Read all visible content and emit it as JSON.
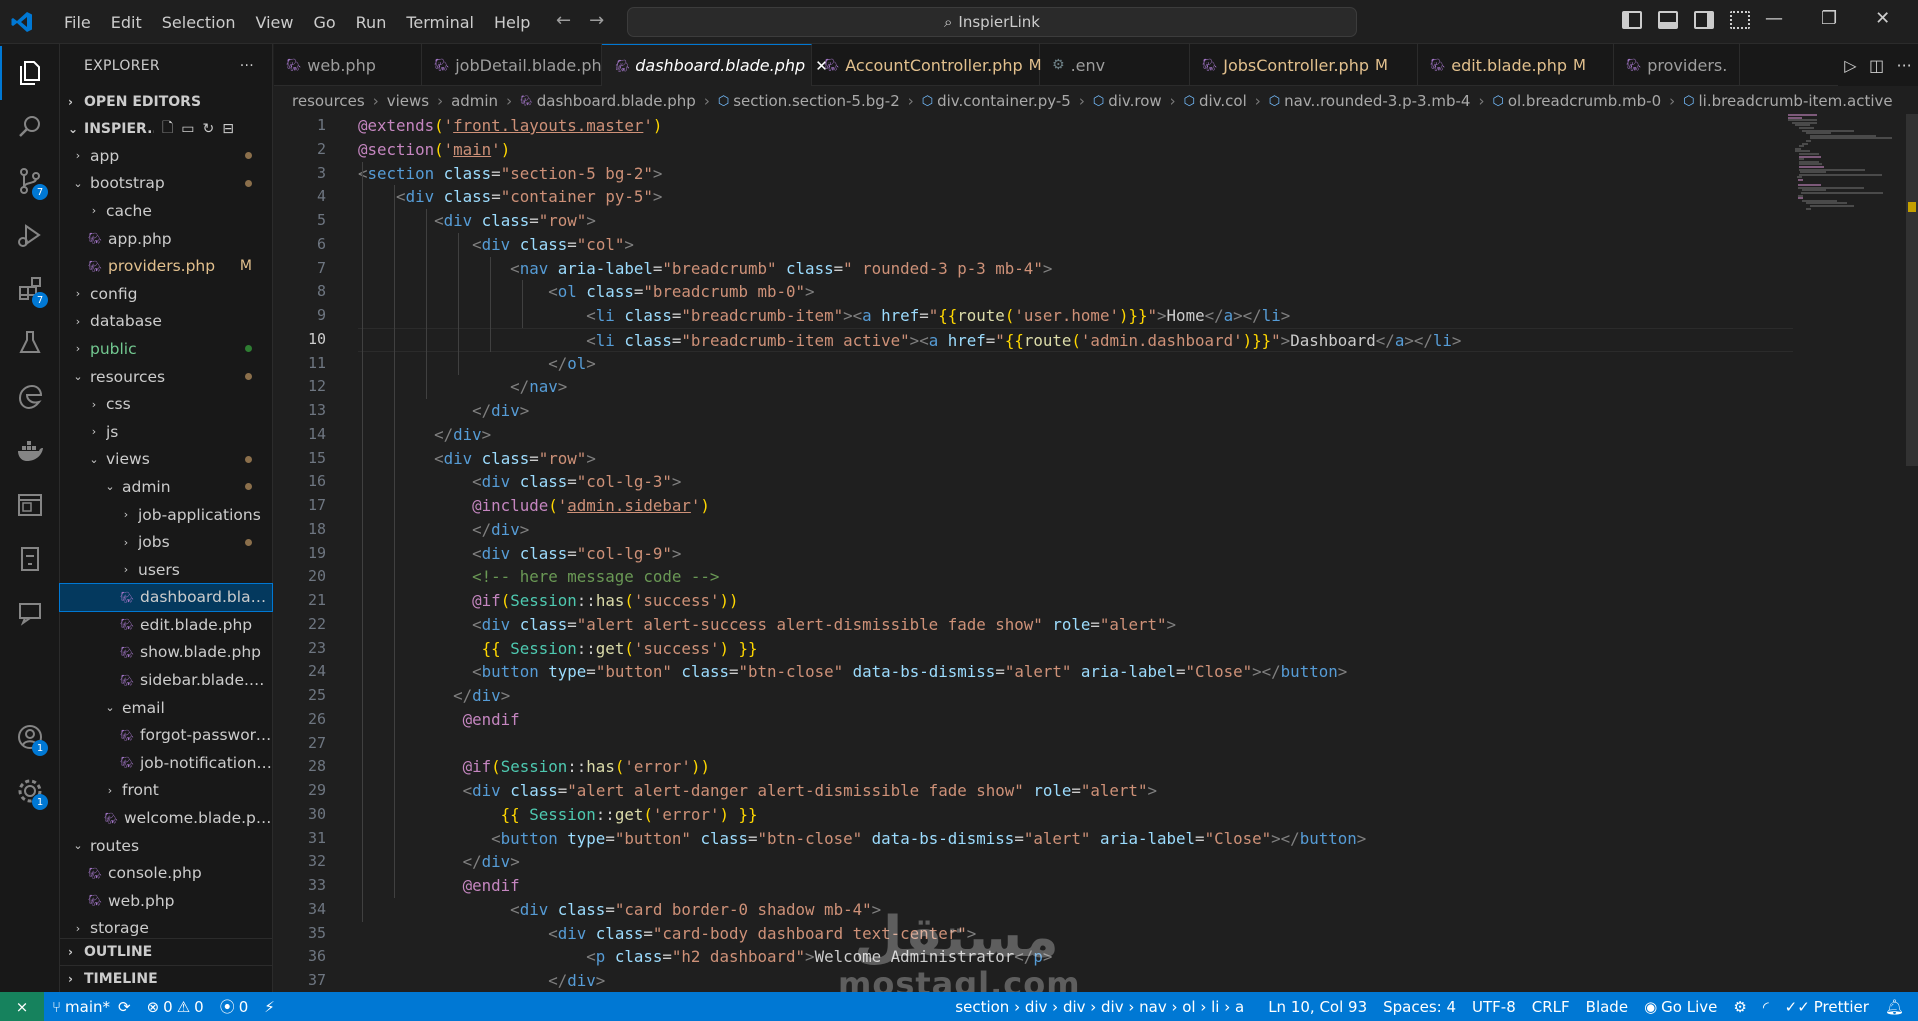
{
  "titlebar": {
    "menu": [
      "File",
      "Edit",
      "Selection",
      "View",
      "Go",
      "Run",
      "Terminal",
      "Help"
    ],
    "search": "InspierLink"
  },
  "activity_bar": {
    "items": [
      {
        "name": "explorer-icon",
        "badge": ""
      },
      {
        "name": "search-icon",
        "badge": ""
      },
      {
        "name": "source-control-icon",
        "badge": "7"
      },
      {
        "name": "run-debug-icon",
        "badge": ""
      },
      {
        "name": "extensions-icon",
        "badge": "7"
      },
      {
        "name": "testing-icon",
        "badge": ""
      },
      {
        "name": "edge-icon",
        "badge": ""
      },
      {
        "name": "docker-icon",
        "badge": ""
      },
      {
        "name": "remote-explorer-icon",
        "badge": ""
      },
      {
        "name": "database-icon",
        "badge": ""
      },
      {
        "name": "live-share-icon",
        "badge": ""
      }
    ],
    "account_badge": "1",
    "settings_badge": "1"
  },
  "sidebar": {
    "title": "EXPLORER",
    "open_editors": "OPEN EDITORS",
    "workspace": "INSPIER...",
    "tree": [
      {
        "label": "app",
        "indent": 0,
        "kind": "folder",
        "open": false,
        "status": "dot"
      },
      {
        "label": "bootstrap",
        "indent": 0,
        "kind": "folder",
        "open": true,
        "status": "dot"
      },
      {
        "label": "cache",
        "indent": 1,
        "kind": "folder",
        "open": false,
        "status": ""
      },
      {
        "label": "app.php",
        "indent": 1,
        "kind": "php",
        "status": ""
      },
      {
        "label": "providers.php",
        "indent": 1,
        "kind": "php",
        "status": "M"
      },
      {
        "label": "config",
        "indent": 0,
        "kind": "folder",
        "open": false,
        "status": ""
      },
      {
        "label": "database",
        "indent": 0,
        "kind": "folder",
        "open": false,
        "status": ""
      },
      {
        "label": "public",
        "indent": 0,
        "kind": "folder",
        "open": false,
        "status": "green"
      },
      {
        "label": "resources",
        "indent": 0,
        "kind": "folder",
        "open": true,
        "status": "dot"
      },
      {
        "label": "css",
        "indent": 1,
        "kind": "folder",
        "open": false,
        "status": ""
      },
      {
        "label": "js",
        "indent": 1,
        "kind": "folder",
        "open": false,
        "status": ""
      },
      {
        "label": "views",
        "indent": 1,
        "kind": "folder",
        "open": true,
        "status": "dot"
      },
      {
        "label": "admin",
        "indent": 2,
        "kind": "folder",
        "open": true,
        "status": "dot"
      },
      {
        "label": "job-applications",
        "indent": 3,
        "kind": "folder",
        "open": false,
        "status": ""
      },
      {
        "label": "jobs",
        "indent": 3,
        "kind": "folder",
        "open": false,
        "status": "dot"
      },
      {
        "label": "users",
        "indent": 3,
        "kind": "folder",
        "open": false,
        "status": ""
      },
      {
        "label": "dashboard.blade....",
        "indent": 3,
        "kind": "php",
        "status": "",
        "selected": true
      },
      {
        "label": "edit.blade.php",
        "indent": 3,
        "kind": "php",
        "status": ""
      },
      {
        "label": "show.blade.php",
        "indent": 3,
        "kind": "php",
        "status": ""
      },
      {
        "label": "sidebar.blade.php",
        "indent": 3,
        "kind": "php",
        "status": ""
      },
      {
        "label": "email",
        "indent": 2,
        "kind": "folder",
        "open": true,
        "status": ""
      },
      {
        "label": "forgot-password....",
        "indent": 3,
        "kind": "php",
        "status": ""
      },
      {
        "label": "job-notification-e...",
        "indent": 3,
        "kind": "php",
        "status": ""
      },
      {
        "label": "front",
        "indent": 2,
        "kind": "folder",
        "open": false,
        "status": ""
      },
      {
        "label": "welcome.blade.php",
        "indent": 2,
        "kind": "php",
        "status": ""
      },
      {
        "label": "routes",
        "indent": 0,
        "kind": "folder",
        "open": true,
        "status": ""
      },
      {
        "label": "console.php",
        "indent": 1,
        "kind": "php",
        "status": ""
      },
      {
        "label": "web.php",
        "indent": 1,
        "kind": "php",
        "status": ""
      },
      {
        "label": "storage",
        "indent": 0,
        "kind": "folder",
        "open": false,
        "status": ""
      }
    ],
    "outline": "OUTLINE",
    "timeline": "TIMELINE"
  },
  "tabs": [
    {
      "label": "web.php",
      "icon": "php",
      "modified": false,
      "active": false
    },
    {
      "label": "jobDetail.blade.php",
      "icon": "php",
      "modified": false,
      "active": false
    },
    {
      "label": "dashboard.blade.php",
      "icon": "php",
      "modified": false,
      "active": true
    },
    {
      "label": "AccountController.php",
      "icon": "php",
      "modified": true,
      "active": false
    },
    {
      "label": ".env",
      "icon": "gear",
      "modified": false,
      "active": false
    },
    {
      "label": "JobsController.php",
      "icon": "php",
      "modified": true,
      "active": false
    },
    {
      "label": "edit.blade.php",
      "icon": "php",
      "modified": true,
      "active": false
    },
    {
      "label": "providers.",
      "icon": "php",
      "modified": false,
      "active": false
    }
  ],
  "breadcrumb": [
    "resources",
    "views",
    "admin",
    "dashboard.blade.php",
    "section.section-5.bg-2",
    "div.container.py-5",
    "div.row",
    "div.col",
    "nav..rounded-3.p-3.mb-4",
    "ol.breadcrumb.mb-0",
    "li.breadcrumb-item.active"
  ],
  "editor": {
    "current_line": 10,
    "lines": [
      "@extends('front.layouts.master')",
      "@section('main')",
      "<section class=\"section-5 bg-2\">",
      "    <div class=\"container py-5\">",
      "        <div class=\"row\">",
      "            <div class=\"col\">",
      "                <nav aria-label=\"breadcrumb\" class=\" rounded-3 p-3 mb-4\">",
      "                    <ol class=\"breadcrumb mb-0\">",
      "                        <li class=\"breadcrumb-item\"><a href=\"{{route('user.home')}}\">Home</a></li>",
      "                        <li class=\"breadcrumb-item active\"><a href=\"{{route('admin.dashboard')}}\">Dashboard</a></li>",
      "                    </ol>",
      "                </nav>",
      "            </div>",
      "        </div>",
      "        <div class=\"row\">",
      "            <div class=\"col-lg-3\">",
      "            @include('admin.sidebar')",
      "            </div>",
      "            <div class=\"col-lg-9\">",
      "            <!-- here message code -->",
      "            @if(Session::has('success'))",
      "            <div class=\"alert alert-success alert-dismissible fade show\" role=\"alert\">",
      "             {{ Session::get('success') }}",
      "            <button type=\"button\" class=\"btn-close\" data-bs-dismiss=\"alert\" aria-label=\"Close\"></button>",
      "          </div>",
      "           @endif",
      "",
      "           @if(Session::has('error'))",
      "           <div class=\"alert alert-danger alert-dismissible fade show\" role=\"alert\">",
      "               {{ Session::get('error') }}",
      "              <button type=\"button\" class=\"btn-close\" data-bs-dismiss=\"alert\" aria-label=\"Close\"></button>",
      "           </div>",
      "           @endif",
      "                <div class=\"card border-0 shadow mb-4\">",
      "                    <div class=\"card-body dashboard text-center\">",
      "                        <p class=\"h2 dashboard\">Welcome Administrator</p>",
      "                    </div>"
    ]
  },
  "statusbar": {
    "branch": "main*",
    "errors": "0",
    "warnings": "0",
    "ports": "0",
    "path": "section › div › div › div › nav › ol › li › a",
    "position": "Ln 10, Col 93",
    "spaces": "Spaces: 4",
    "encoding": "UTF-8",
    "eol": "CRLF",
    "language": "Blade",
    "golive": "Go Live",
    "prettier": "Prettier"
  },
  "watermark": {
    "arabic": "مستقل",
    "latin": "mostaql.com"
  }
}
